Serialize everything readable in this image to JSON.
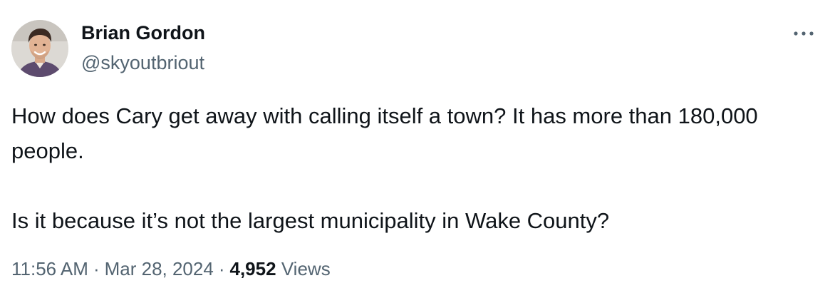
{
  "author": {
    "name": "Brian Gordon",
    "handle": "@skyoutbriout",
    "avatar_icon": "profile-photo"
  },
  "menu": {
    "icon": "more-horizontal-icon"
  },
  "tweet": {
    "text": "How does Cary get away with calling itself a town? It has more than 180,000 people.\n\nIs it because it’s not the largest municipality in Wake County?"
  },
  "meta": {
    "time": "11:56 AM",
    "separator": "·",
    "date": "Mar 28, 2024",
    "views_count": "4,952",
    "views_label": "Views"
  },
  "colors": {
    "text_primary": "#0f1419",
    "text_secondary": "#536471",
    "background": "#ffffff"
  }
}
